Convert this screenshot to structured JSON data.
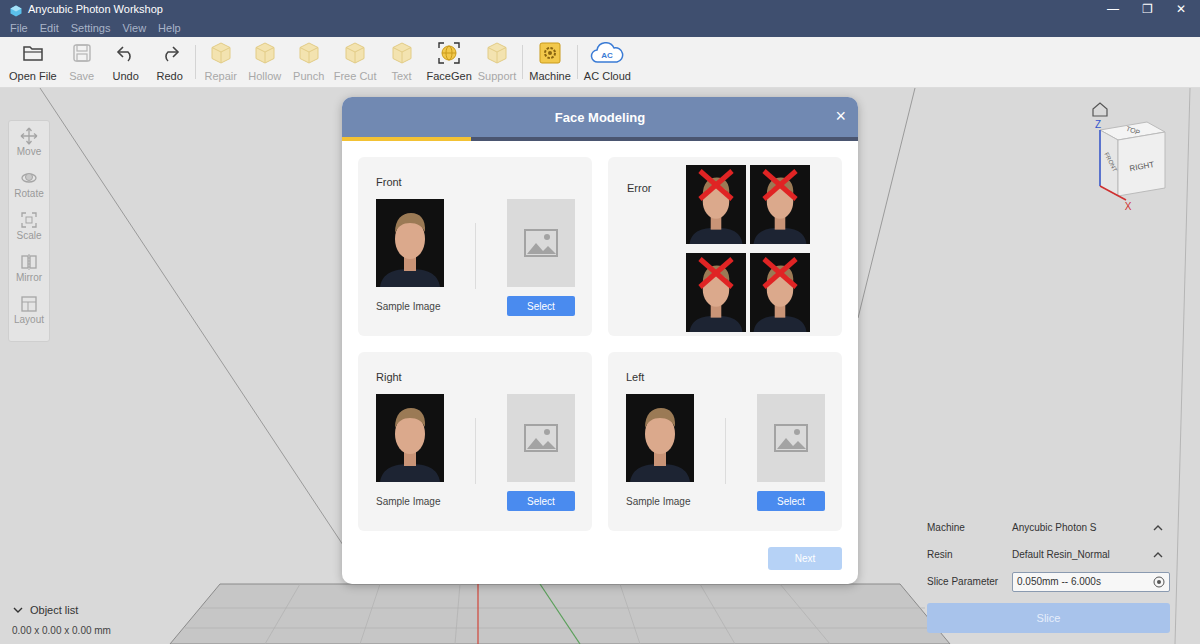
{
  "window": {
    "title": "Anycubic Photon Workshop",
    "controls": [
      "—",
      "❐",
      "✕"
    ]
  },
  "menu": [
    "File",
    "Edit",
    "Settings",
    "View",
    "Help"
  ],
  "toolbar": [
    {
      "label": "Open File",
      "disabled": false
    },
    {
      "label": "Save",
      "disabled": true
    },
    {
      "label": "Undo",
      "disabled": false
    },
    {
      "label": "Redo",
      "disabled": false
    },
    {
      "label": "Repair",
      "disabled": true
    },
    {
      "label": "Hollow",
      "disabled": true
    },
    {
      "label": "Punch",
      "disabled": true
    },
    {
      "label": "Free Cut",
      "disabled": true
    },
    {
      "label": "Text",
      "disabled": true
    },
    {
      "label": "FaceGen",
      "disabled": false
    },
    {
      "label": "Support",
      "disabled": true
    },
    {
      "label": "Machine",
      "disabled": false
    },
    {
      "label": "AC Cloud",
      "disabled": false,
      "badge": "AC"
    }
  ],
  "tools": [
    {
      "label": "Move",
      "disabled": true
    },
    {
      "label": "Rotate",
      "disabled": true
    },
    {
      "label": "Scale",
      "disabled": true
    },
    {
      "label": "Mirror",
      "disabled": true
    },
    {
      "label": "Layout",
      "disabled": true
    }
  ],
  "view_cube": {
    "faces": [
      "TOP",
      "FRONT",
      "RIGHT"
    ],
    "axes": [
      "Z",
      "X"
    ]
  },
  "object_list": {
    "label": "Object list",
    "expanded": true,
    "dimensions": "0.00 x 0.00 x 0.00 mm"
  },
  "settings": [
    {
      "label": "Machine",
      "value": "Anycubic Photon S",
      "kind": "dropdown"
    },
    {
      "label": "Resin",
      "value": "Default Resin_Normal",
      "kind": "dropdown"
    },
    {
      "label": "Slice Parameter",
      "value": "0.050mm -- 6.000s",
      "kind": "field"
    }
  ],
  "slice_button": {
    "label": "Slice",
    "disabled": true
  },
  "dialog": {
    "title": "Face Modeling",
    "close": "×",
    "progress": 0.25,
    "cards": [
      {
        "title": "Front",
        "kind": "upload",
        "caption": "Sample Image",
        "button": "Select"
      },
      {
        "title": "Error",
        "kind": "examples",
        "examples": [
          {
            "crossed": true
          },
          {
            "crossed": true
          },
          {
            "crossed": true
          },
          {
            "crossed": true
          }
        ]
      },
      {
        "title": "Right",
        "kind": "upload",
        "caption": "Sample Image",
        "button": "Select"
      },
      {
        "title": "Left",
        "kind": "upload",
        "caption": "Sample Image",
        "button": "Select"
      }
    ],
    "next": {
      "label": "Next",
      "disabled": true
    }
  }
}
